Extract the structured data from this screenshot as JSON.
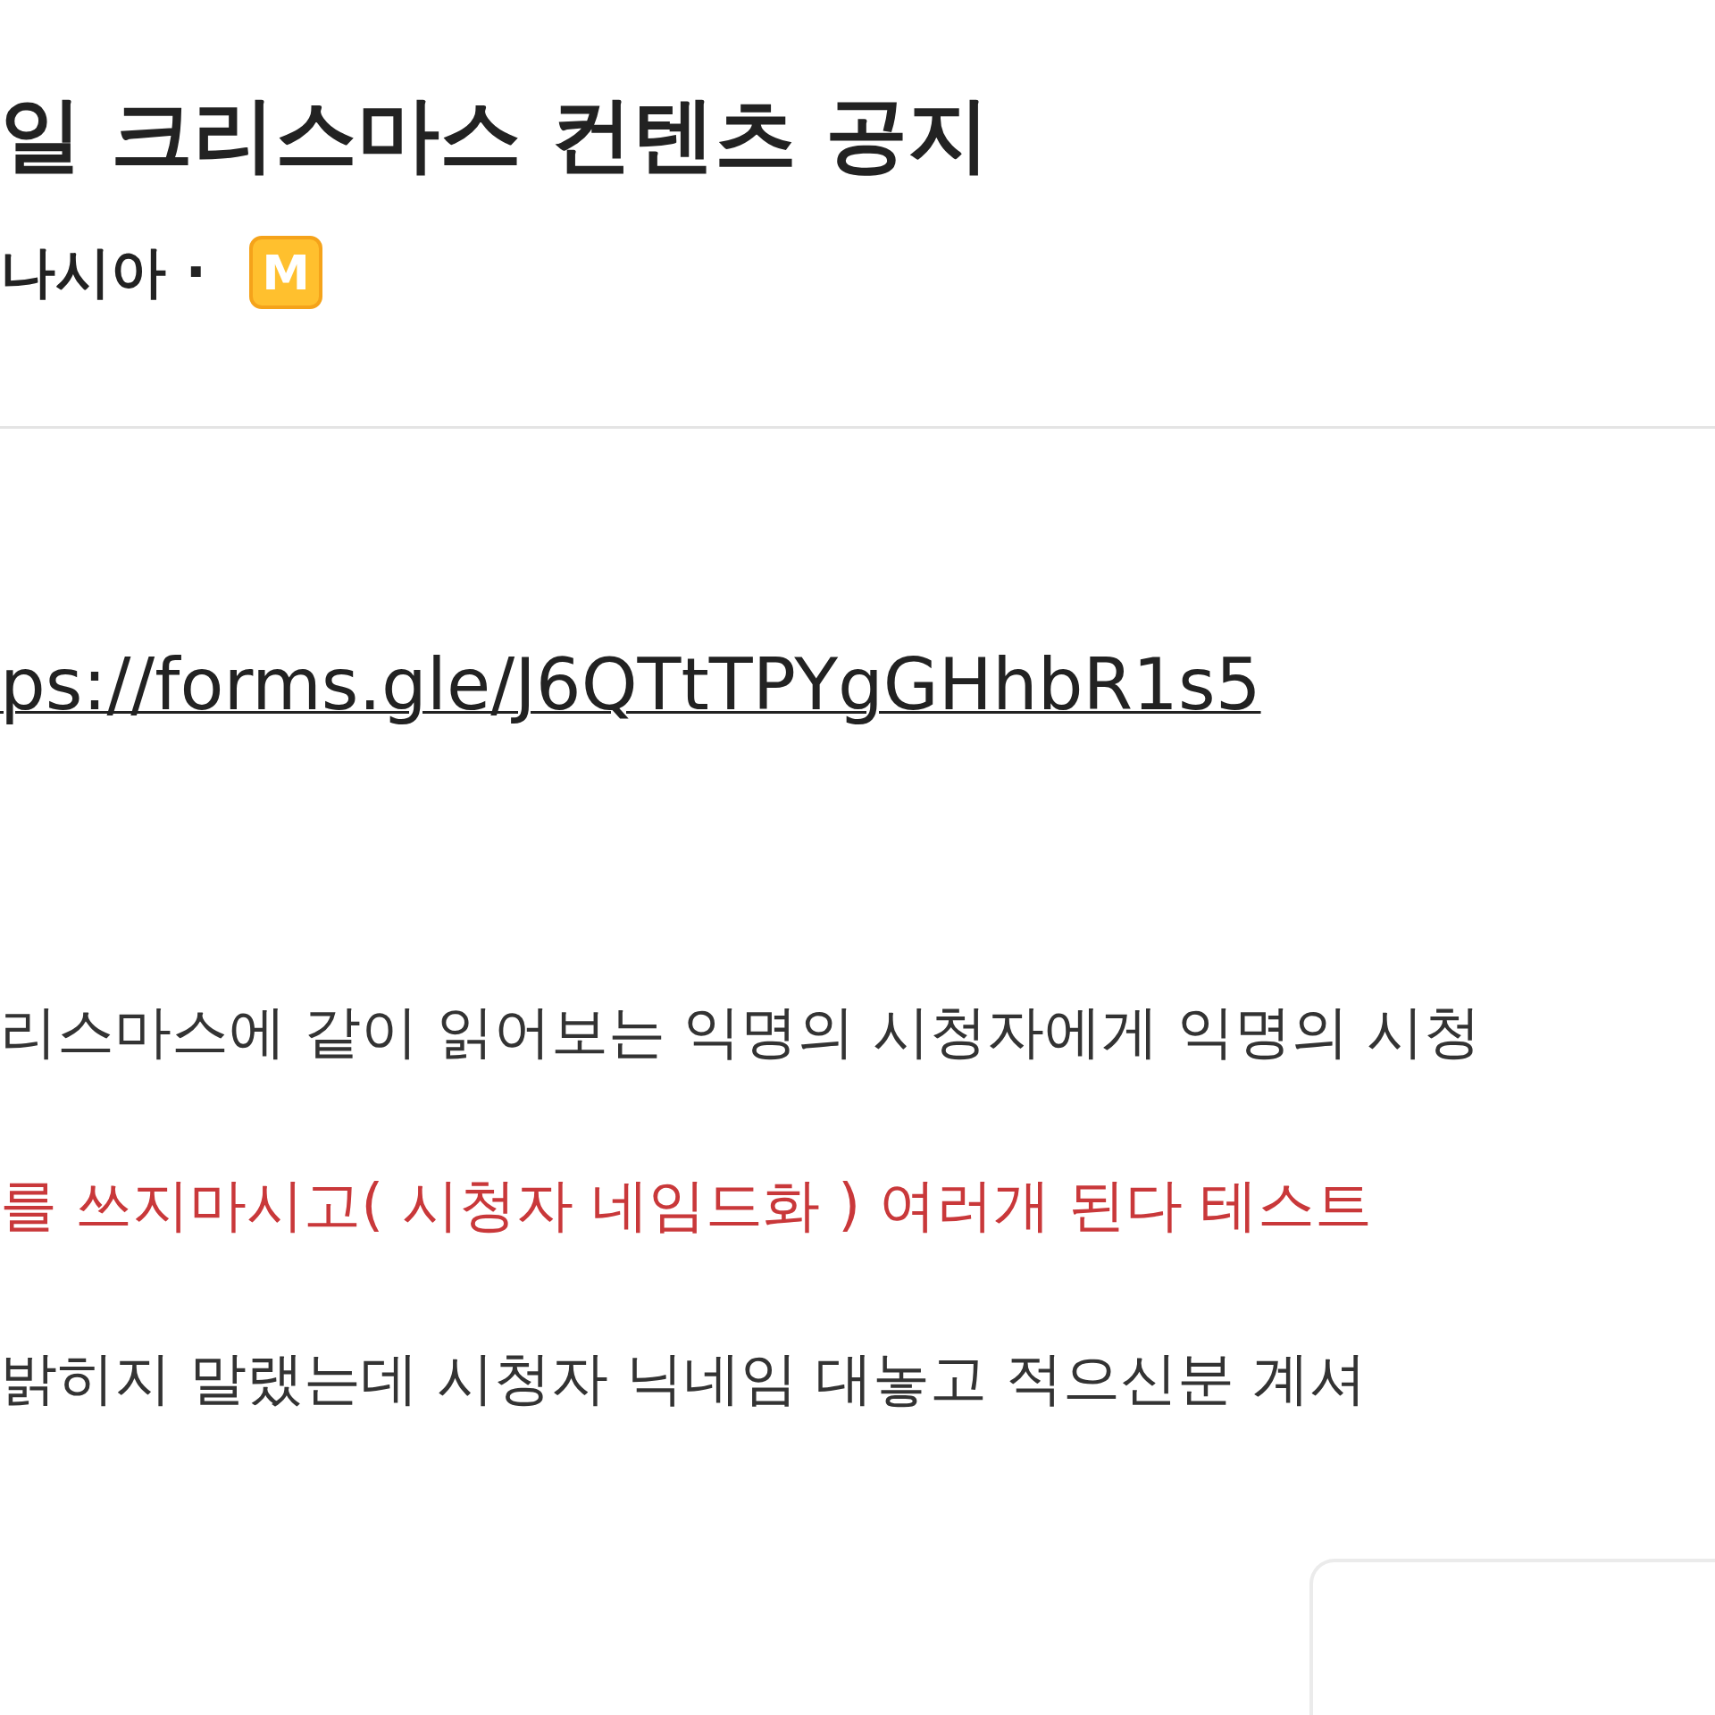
{
  "post": {
    "title": "일 크리스마스 컨텐츠 공지",
    "author": "나시아 ·",
    "badge": "M",
    "link": "ps://forms.gle/J6QTtTPYgGHhbR1s5",
    "paragraphs": [
      {
        "text": "리스마스에 같이 읽어보는 익명의 시청자에게 익명의 시청",
        "color": "#333333"
      },
      {
        "text": "를 쓰지마시고( 시청자 네임드화 ) 여러개 된다 테스트",
        "color": "#c9383a"
      },
      {
        "text": "밝히지 말랬는데 시청자 닉네임 대놓고 적으신분 계셔",
        "color": "#333333"
      }
    ]
  }
}
